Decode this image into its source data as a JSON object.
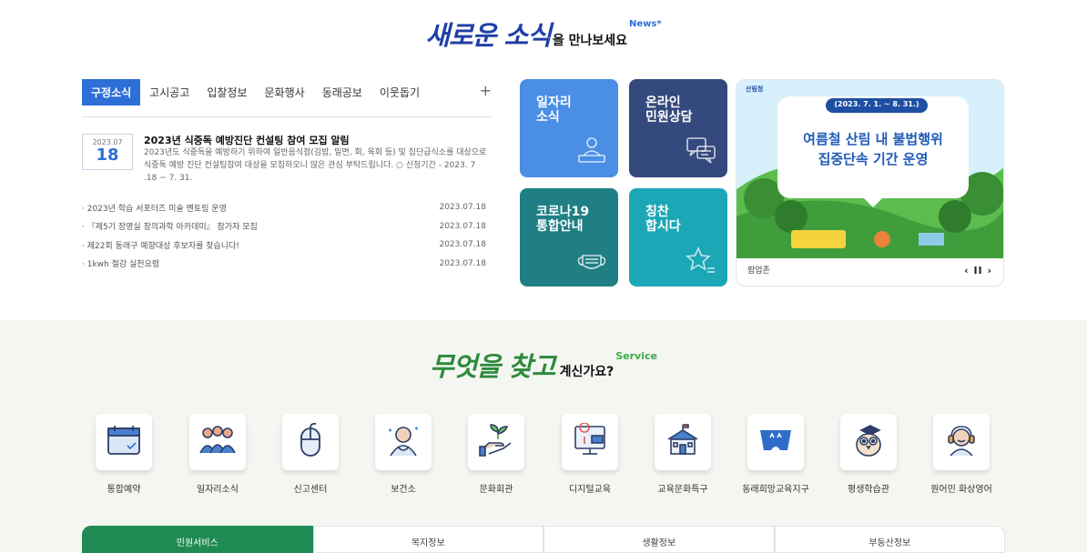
{
  "news_heading": {
    "script": "새로운 소식",
    "sub": "을 만나보세요",
    "tag": "News*"
  },
  "tabs": [
    "구정소식",
    "고시공고",
    "입찰정보",
    "문화행사",
    "동래공보",
    "이웃돕기"
  ],
  "tabs_more": "+",
  "featured": {
    "ym": "2023.07",
    "day": "18",
    "title": "2023년 식중독 예방진단 컨설팅 참여 모집 알림",
    "desc": "2023년도 식중독을 예방하기 위하여 일반음식점(김밥, 밀면, 회, 육회 등) 및 집단급식소를 대상으로 식중독 예방 진단 컨설팅참여 대상을 모집하오니 많은 관심 부탁드립니다. ○ 신청기간 - 2023. 7 .18 ~ 7. 31."
  },
  "news_list": [
    {
      "title": "· 2023년 학습 서포터즈 미술 멘토링 운영",
      "date": "2023.07.18"
    },
    {
      "title": "· 『제5기 장영실 창의과학 아카데미』 참가자 모집",
      "date": "2023.07.18"
    },
    {
      "title": "· 제22회 동래구 예향대상 후보자를 찾습니다!",
      "date": "2023.07.18"
    },
    {
      "title": "· 1kwh 절감 실천요령",
      "date": "2023.07.18"
    }
  ],
  "tiles": [
    {
      "label": "일자리\n소식",
      "icon": "worker-desk-icon",
      "color": "#4a8ee6"
    },
    {
      "label": "온라인\n민원상담",
      "icon": "chat-bubbles-icon",
      "color": "#34497d"
    },
    {
      "label": "코로나19\n통합안내",
      "icon": "mask-icon",
      "color": "#1f7f85"
    },
    {
      "label": "칭찬\n합시다",
      "icon": "star-icon",
      "color": "#1ba7b5"
    }
  ],
  "banner": {
    "agency": "산림청",
    "period": "(2023. 7. 1. ~ 8. 31.)",
    "line1": "여름철 산림 내 불법행위",
    "line2": "집중단속 기간 운영",
    "caption": "팝업존",
    "controls": "‹ II ›"
  },
  "service_heading": {
    "script": "무엇을 찾고",
    "sub": "계신가요?",
    "tag": "Service"
  },
  "services": [
    {
      "name": "통합예약",
      "icon": "calendar-icon"
    },
    {
      "name": "일자리소식",
      "icon": "people-group-icon"
    },
    {
      "name": "신고센터",
      "icon": "mouse-icon"
    },
    {
      "name": "보건소",
      "icon": "doctor-icon"
    },
    {
      "name": "문화회관",
      "icon": "hand-plant-icon"
    },
    {
      "name": "디지털교육",
      "icon": "digital-map-icon"
    },
    {
      "name": "교육문화특구",
      "icon": "school-icon"
    },
    {
      "name": "동래희망교육지구",
      "icon": "bridge-logo-icon"
    },
    {
      "name": "평생학습관",
      "icon": "owl-icon"
    },
    {
      "name": "원어민 화상영어",
      "icon": "headset-avatar-icon"
    }
  ],
  "bottom_tabs": [
    "민원서비스",
    "복지정보",
    "생활정보",
    "부동산정보"
  ]
}
